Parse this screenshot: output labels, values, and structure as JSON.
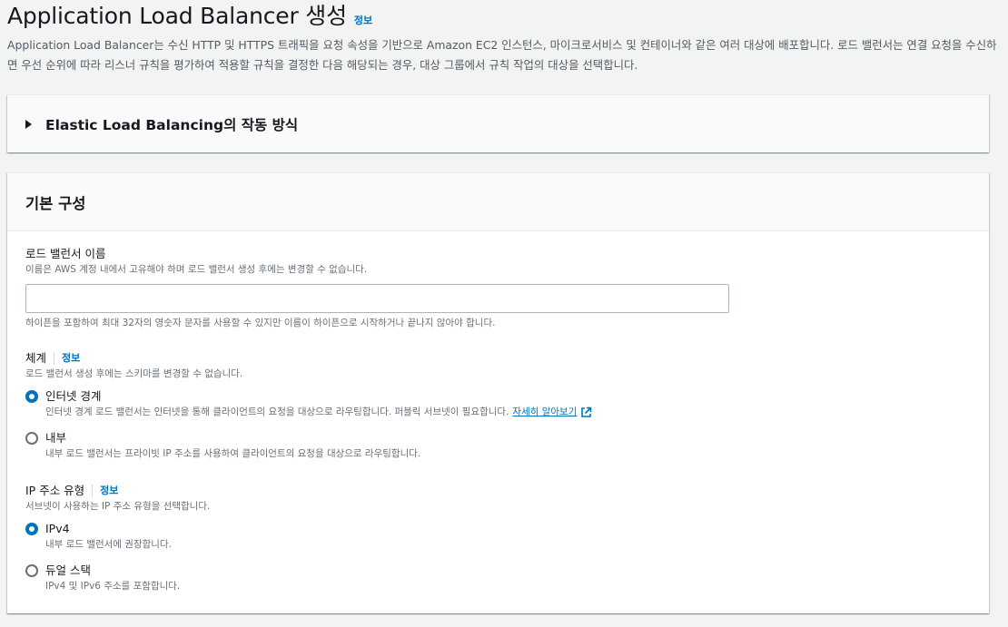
{
  "header": {
    "title": "Application Load Balancer 생성",
    "info": "정보",
    "description": "Application Load Balancer는 수신 HTTP 및 HTTPS 트래픽을 요청 속성을 기반으로 Amazon EC2 인스턴스, 마이크로서비스 및 컨테이너와 같은 여러 대상에 배포합니다. 로드 밸런서는 연결 요청을 수신하면 우선 순위에 따라 리스너 규칙을 평가하여 적용할 규칙을 결정한 다음 해당되는 경우, 대상 그룹에서 규칙 작업의 대상을 선택합니다."
  },
  "expandable": {
    "title": "Elastic Load Balancing의 작동 방식"
  },
  "basic_config": {
    "title": "기본 구성",
    "name_field": {
      "label": "로드 밸런서 이름",
      "description": "이름은 AWS 계정 내에서 고유해야 하며 로드 밸런서 생성 후에는 변경할 수 없습니다.",
      "value": "",
      "hint": "하이픈을 포함하여 최대 32자의 영숫자 문자를 사용할 수 있지만 이름이 하이픈으로 시작하거나 끝나지 않아야 합니다."
    },
    "scheme": {
      "label": "체계",
      "info": "정보",
      "description": "로드 밸런서 생성 후에는 스키마를 변경할 수 없습니다.",
      "options": [
        {
          "label": "인터넷 경계",
          "description": "인터넷 경계 로드 밸런서는 인터넷을 통해 클라이언트의 요청을 대상으로 라우팅합니다. 퍼블릭 서브넷이 필요합니다.",
          "link": "자세히 알아보기",
          "checked": true
        },
        {
          "label": "내부",
          "description": "내부 로드 밸런서는 프라이빗 IP 주소를 사용하여 클라이언트의 요청을 대상으로 라우팅합니다.",
          "checked": false
        }
      ]
    },
    "ip_type": {
      "label": "IP 주소 유형",
      "info": "정보",
      "description": "서브넷이 사용하는 IP 주소 유형을 선택합니다.",
      "options": [
        {
          "label": "IPv4",
          "description": "내부 로드 밸런서에 권장합니다.",
          "checked": true
        },
        {
          "label": "듀얼 스택",
          "description": "IPv4 및 IPv6 주소를 포함합니다.",
          "checked": false
        }
      ]
    }
  },
  "colors": {
    "accent": "#0073bb",
    "background": "#f2f3f3",
    "text": "#16191f",
    "muted": "#687078"
  }
}
